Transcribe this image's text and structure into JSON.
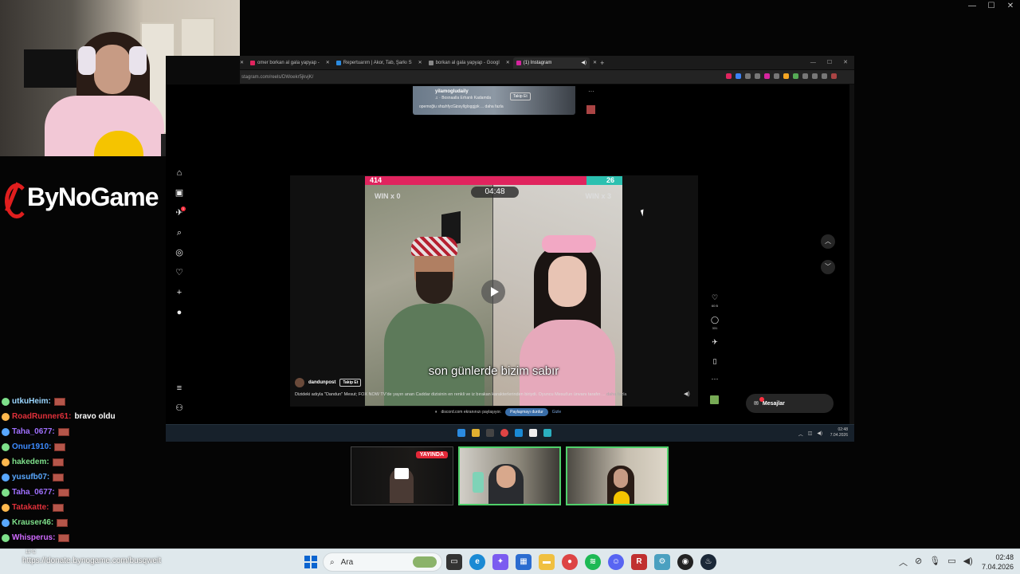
{
  "stream": {
    "logo_text": "ByNoGame",
    "donate_url": "https://donate.bynogame.com/busqweit"
  },
  "chat": [
    {
      "user": "utkuHeim:",
      "color": "#9ad6ff",
      "text": "",
      "emote": true
    },
    {
      "user": "RoadRunner61:",
      "color": "#e0303a",
      "text": "bravo oldu",
      "emote": false
    },
    {
      "user": "Taha_0677:",
      "color": "#a070ff",
      "text": "",
      "emote": true
    },
    {
      "user": "Onur1910:",
      "color": "#3d8bff",
      "text": "",
      "emote": true
    },
    {
      "user": "hakedem:",
      "color": "#7ee08a",
      "text": "",
      "emote": true
    },
    {
      "user": "yusufb07:",
      "color": "#59a8ff",
      "text": "",
      "emote": true
    },
    {
      "user": "Taha_0677:",
      "color": "#a070ff",
      "text": "",
      "emote": true
    },
    {
      "user": "Tatakatte:",
      "color": "#e0303a",
      "text": "",
      "emote": true
    },
    {
      "user": "Krauser46:",
      "color": "#7ee08a",
      "text": "",
      "emote": true
    },
    {
      "user": "Whisperus:",
      "color": "#d06aff",
      "text": "",
      "emote": true
    },
    {
      "user": "Whisperus:",
      "color": "#d06aff",
      "text": "",
      "emote": true
    }
  ],
  "browser": {
    "tabs": [
      {
        "label": "omer borkan al gala yapyap -",
        "color": "#e0245e",
        "active": false
      },
      {
        "label": "Repertuarım | Akor, Tab, Şarkı S",
        "color": "#2b8be0",
        "active": false
      },
      {
        "label": "borkan al gala yapyap - Googl",
        "color": "#888888",
        "active": false
      },
      {
        "label": "(1) Instagram",
        "color": "#d6249f",
        "active": true
      }
    ],
    "new_tab": "+",
    "url": "stagram.com/reels/DWoekr5jkvjK/"
  },
  "instagram": {
    "prev_reel": {
      "user": "yilamogludaily",
      "audio": "♫ · Bosnaalla Erhanlı Kadamda",
      "caption": "opemoğlu shr̶shfycGi̶nsyllgloggjpk ... daha fazla",
      "follow": "Takip Et"
    },
    "reel": {
      "score_left": "414",
      "score_right": "26",
      "win_left": "WIN x 0",
      "win_right": "WIN x 3",
      "timer": "04:48",
      "subtitle": "son günlerde bizim sabır",
      "user": "dandunpost",
      "follow": "Takip Et",
      "caption": "Dizideki adıyla \"Dandun\" Mesut; FOX NOW TV'de yayın anan Caddar dizisinin en renkli ve iz bırakan karakterlerinden biriydi. Oyuncu Mesut'un ünvanı tarafın ...",
      "caption_more": "daha fazla"
    },
    "actions": {
      "like_count": "60 B",
      "comment_count": "331"
    },
    "messages_label": "Mesajlar",
    "notif_count": "1",
    "share": {
      "text": "discord.com ekranınızı paylaşıyor.",
      "stop": "Paylaşmayı durdur",
      "hide": "Gizle"
    }
  },
  "inner_taskbar": {
    "time": "02:48",
    "date": "7.04.2026"
  },
  "guests": {
    "live_label": "YAYINDA"
  },
  "taskbar": {
    "search_placeholder": "Ara",
    "time": "02:48",
    "date": "7.04.2026",
    "weather": "11°C"
  }
}
